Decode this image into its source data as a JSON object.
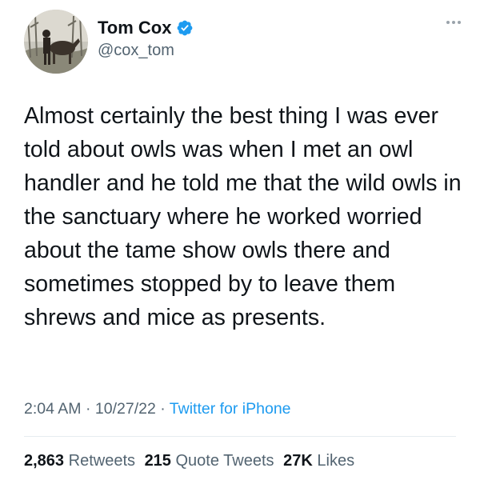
{
  "author": {
    "display_name": "Tom Cox",
    "handle": "@cox_tom",
    "verified": true,
    "avatar_icon": "man-with-horse-avatar"
  },
  "tweet": {
    "text": "Almost certainly the best thing I was ever told about owls was when I met an owl handler and he told me that the wild owls in the sanctuary where he worked worried about the tame show owls there and sometimes stopped by to leave them shrews and mice as presents."
  },
  "meta": {
    "time": "2:04 AM",
    "sep1": " · ",
    "date": "10/27/22",
    "sep2": " · ",
    "source": "Twitter for iPhone"
  },
  "stats": {
    "retweets_count": "2,863",
    "retweets_label": "Retweets",
    "quotes_count": "215",
    "quotes_label": "Quote Tweets",
    "likes_count": "27K",
    "likes_label": "Likes"
  },
  "colors": {
    "accent": "#1d9bf0",
    "text": "#0f1419",
    "secondary": "#536471"
  }
}
